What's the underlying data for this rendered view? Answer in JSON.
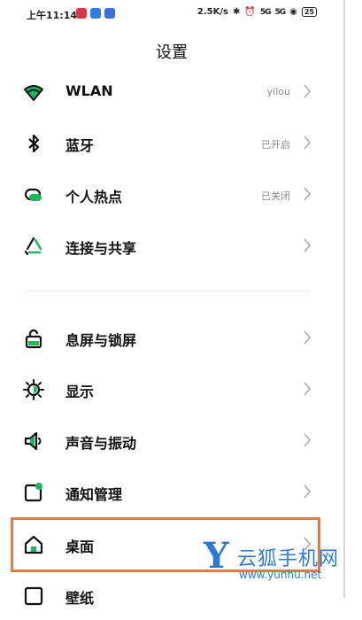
{
  "status_bar": {
    "time": "上午11:14",
    "net_speed": "2.5K/s",
    "bluetooth": "✱",
    "alarm": "⏰",
    "signal1": "5G",
    "signal2": "5G",
    "wifi": "◉",
    "battery": "25"
  },
  "header": {
    "title": "设置"
  },
  "rows": [
    {
      "label": "WLAN",
      "value": "yilou",
      "icon": "wifi-icon"
    },
    {
      "label": "蓝牙",
      "value": "已开启",
      "icon": "bluetooth-icon"
    },
    {
      "label": "个人热点",
      "value": "已关闭",
      "icon": "hotspot-icon"
    },
    {
      "label": "连接与共享",
      "value": "",
      "icon": "share-icon"
    },
    {
      "label": "息屏与锁屏",
      "value": "",
      "icon": "lock-icon"
    },
    {
      "label": "显示",
      "value": "",
      "icon": "display-icon"
    },
    {
      "label": "声音与振动",
      "value": "",
      "icon": "sound-icon"
    },
    {
      "label": "通知管理",
      "value": "",
      "icon": "notification-icon"
    },
    {
      "label": "桌面",
      "value": "",
      "icon": "home-icon"
    },
    {
      "label": "壁纸",
      "value": "",
      "icon": "wallpaper-icon"
    }
  ],
  "watermark": {
    "brand": "云狐手机网",
    "letter": "Y",
    "url": "www.yunhu.net"
  },
  "colors": {
    "accent_green": "#1db85a",
    "highlight": "#e07b45",
    "watermark_blue": "#2b7bd6"
  }
}
